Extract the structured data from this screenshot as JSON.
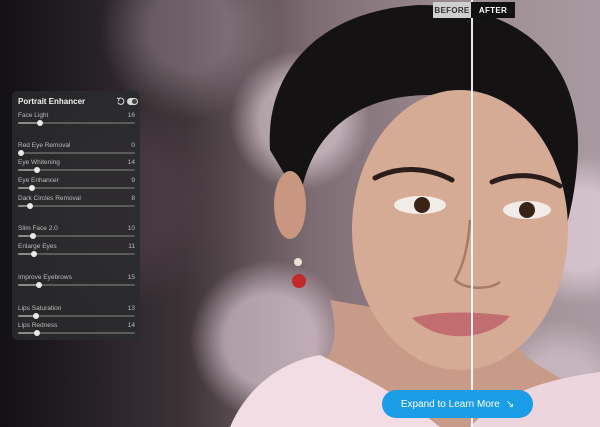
{
  "compare": {
    "before_label": "BEFORE",
    "after_label": "AFTER"
  },
  "panel": {
    "title": "Portrait Enhancer",
    "sliders": [
      {
        "label": "Face Light",
        "value": "16",
        "level": 0.16
      },
      {
        "label": "Red Eye Removal",
        "value": "0",
        "level": 0.0
      },
      {
        "label": "Eye Whitening",
        "value": "14",
        "level": 0.14
      },
      {
        "label": "Eye Enhancer",
        "value": "9",
        "level": 0.09
      },
      {
        "label": "Dark Circles Removal",
        "value": "8",
        "level": 0.08
      },
      {
        "label": "Slim Face 2.0",
        "value": "10",
        "level": 0.1
      },
      {
        "label": "Enlarge Eyes",
        "value": "11",
        "level": 0.11
      },
      {
        "label": "Improve Eyebrows",
        "value": "15",
        "level": 0.15
      },
      {
        "label": "Lips Saturation",
        "value": "13",
        "level": 0.13
      },
      {
        "label": "Lips Redness",
        "value": "14",
        "level": 0.14
      }
    ]
  },
  "cta": {
    "label": "Expand to Learn More",
    "icon": "arrow-down-right-icon"
  },
  "colors": {
    "accent": "#1a9ce6",
    "panel": "#2a2a2c"
  }
}
